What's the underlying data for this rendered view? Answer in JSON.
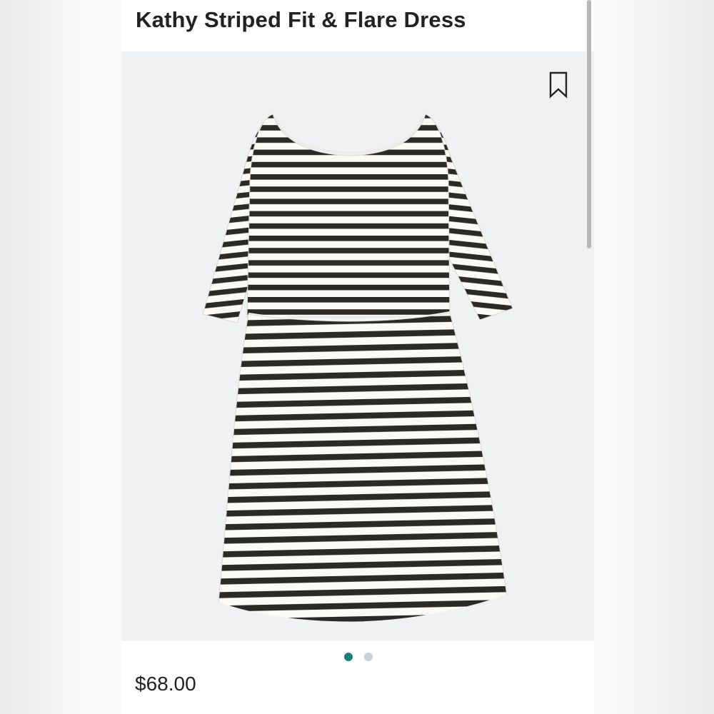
{
  "product": {
    "title": "Kathy Striped Fit & Flare Dress",
    "price": "$68.00",
    "image_alt_subject": "black and white striped fit and flare dress"
  },
  "bookmark": {
    "icon": "bookmark-icon"
  },
  "carousel": {
    "dots": [
      {
        "active": true
      },
      {
        "active": false
      }
    ],
    "active_color": "#1b7f7a",
    "inactive_color": "#cfd2d4"
  },
  "colors": {
    "stripe_dark": "#2b2a27",
    "stripe_light": "#fbfaf4",
    "image_background": "#f0f1f3"
  }
}
